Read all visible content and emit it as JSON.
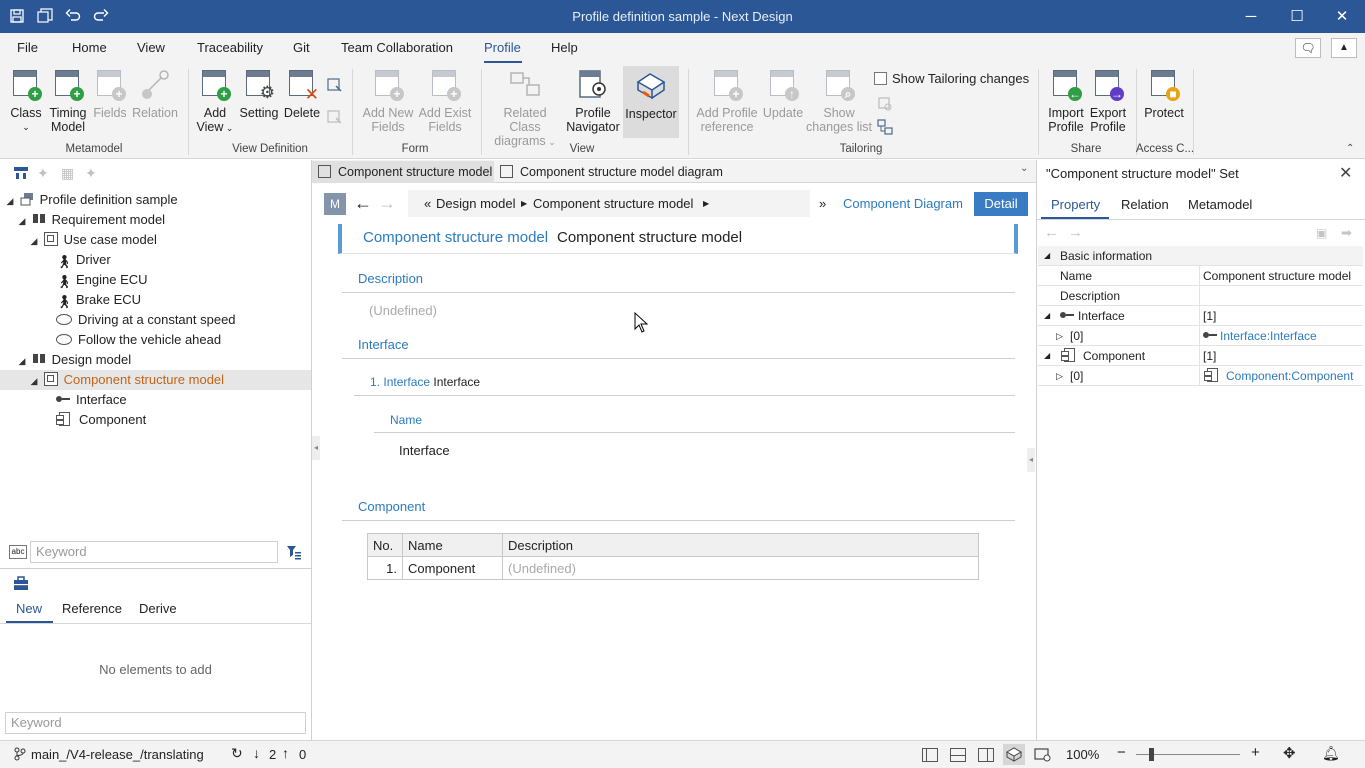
{
  "window": {
    "title": "Profile definition sample - Next Design"
  },
  "menu": {
    "items": [
      "File",
      "Home",
      "View",
      "Traceability",
      "Git",
      "Team Collaboration",
      "Profile",
      "Help"
    ],
    "active": "Profile"
  },
  "ribbon": {
    "buttons": {
      "class": "Class",
      "timing_model_1": "Timing",
      "timing_model_2": "Model",
      "fields": "Fields",
      "relation": "Relation",
      "add_view_1": "Add",
      "add_view_2": "View",
      "setting": "Setting",
      "delete": "Delete",
      "add_new_fields_1": "Add New",
      "add_new_fields_2": "Fields",
      "add_exist_fields_1": "Add Exist",
      "add_exist_fields_2": "Fields",
      "related_class_1": "Related Class",
      "related_class_2": "diagrams",
      "profile_navigator_1": "Profile",
      "profile_navigator_2": "Navigator",
      "inspector": "Inspector",
      "add_profile_ref_1": "Add Profile",
      "add_profile_ref_2": "reference",
      "update": "Update",
      "show_changes_1": "Show",
      "show_changes_2": "changes list",
      "show_tailoring": "Show Tailoring changes",
      "import_profile_1": "Import",
      "import_profile_2": "Profile",
      "export_profile_1": "Export",
      "export_profile_2": "Profile",
      "protect": "Protect"
    },
    "groups": {
      "metamodel": "Metamodel",
      "view_definition": "View Definition",
      "form": "Form",
      "view": "View",
      "tailoring": "Tailoring",
      "share": "Share",
      "access": "Access C..."
    }
  },
  "tree": {
    "root": "Profile definition sample",
    "requirement_model": "Requirement model",
    "use_case_model": "Use case model",
    "driver": "Driver",
    "engine_ecu": "Engine ECU",
    "brake_ecu": "Brake ECU",
    "driving_constant": "Driving at a constant speed",
    "follow_vehicle": "Follow the vehicle ahead",
    "design_model": "Design model",
    "component_structure_model": "Component structure model",
    "interface": "Interface",
    "component": "Component"
  },
  "left_panel": {
    "keyword_placeholder": "Keyword",
    "tabs": [
      "New",
      "Reference",
      "Derive"
    ],
    "no_elements": "No elements to add",
    "keyword_placeholder_2": "Keyword"
  },
  "editor": {
    "tabs": [
      "Component structure model",
      "Component structure model diagram"
    ],
    "badge": "M",
    "breadcrumb": {
      "prefix": "«",
      "design_model": "Design model",
      "component_structure_model": "Component structure model",
      "suffix": "»"
    },
    "component_diagram_link": "Component Diagram",
    "detail_button": "Detail",
    "header_class": "Component structure model",
    "header_name": "Component structure model",
    "description_label": "Description",
    "description_value": "(Undefined)",
    "interface_label": "Interface",
    "interface_item_index": "1.",
    "interface_item_class": "Interface",
    "interface_item_name": "Interface",
    "interface_name_label": "Name",
    "interface_name_value": "Interface",
    "component_label": "Component",
    "component_table": {
      "headers": [
        "No.",
        "Name",
        "Description"
      ],
      "rows": [
        [
          "1.",
          "Component",
          "(Undefined)"
        ]
      ]
    }
  },
  "properties": {
    "title": "\"Component structure model\" Set",
    "tabs": [
      "Property",
      "Relation",
      "Metamodel"
    ],
    "section": "Basic information",
    "name_label": "Name",
    "name_value": "Component structure model",
    "description_label": "Description",
    "interface_label": "Interface",
    "interface_count": "[1]",
    "interface_index": "[0]",
    "interface_link": "Interface:Interface",
    "component_label": "Component",
    "component_count": "[1]",
    "component_index": "[0]",
    "component_link": "Component:Component"
  },
  "status": {
    "branch": "main_/V4-release_/translating",
    "pull_count": "2",
    "push_count": "0",
    "zoom": "100%"
  },
  "colors": {
    "titlebar": "#2b5797",
    "accent": "#2b7bc0",
    "detail_button": "#3a7cc4"
  }
}
